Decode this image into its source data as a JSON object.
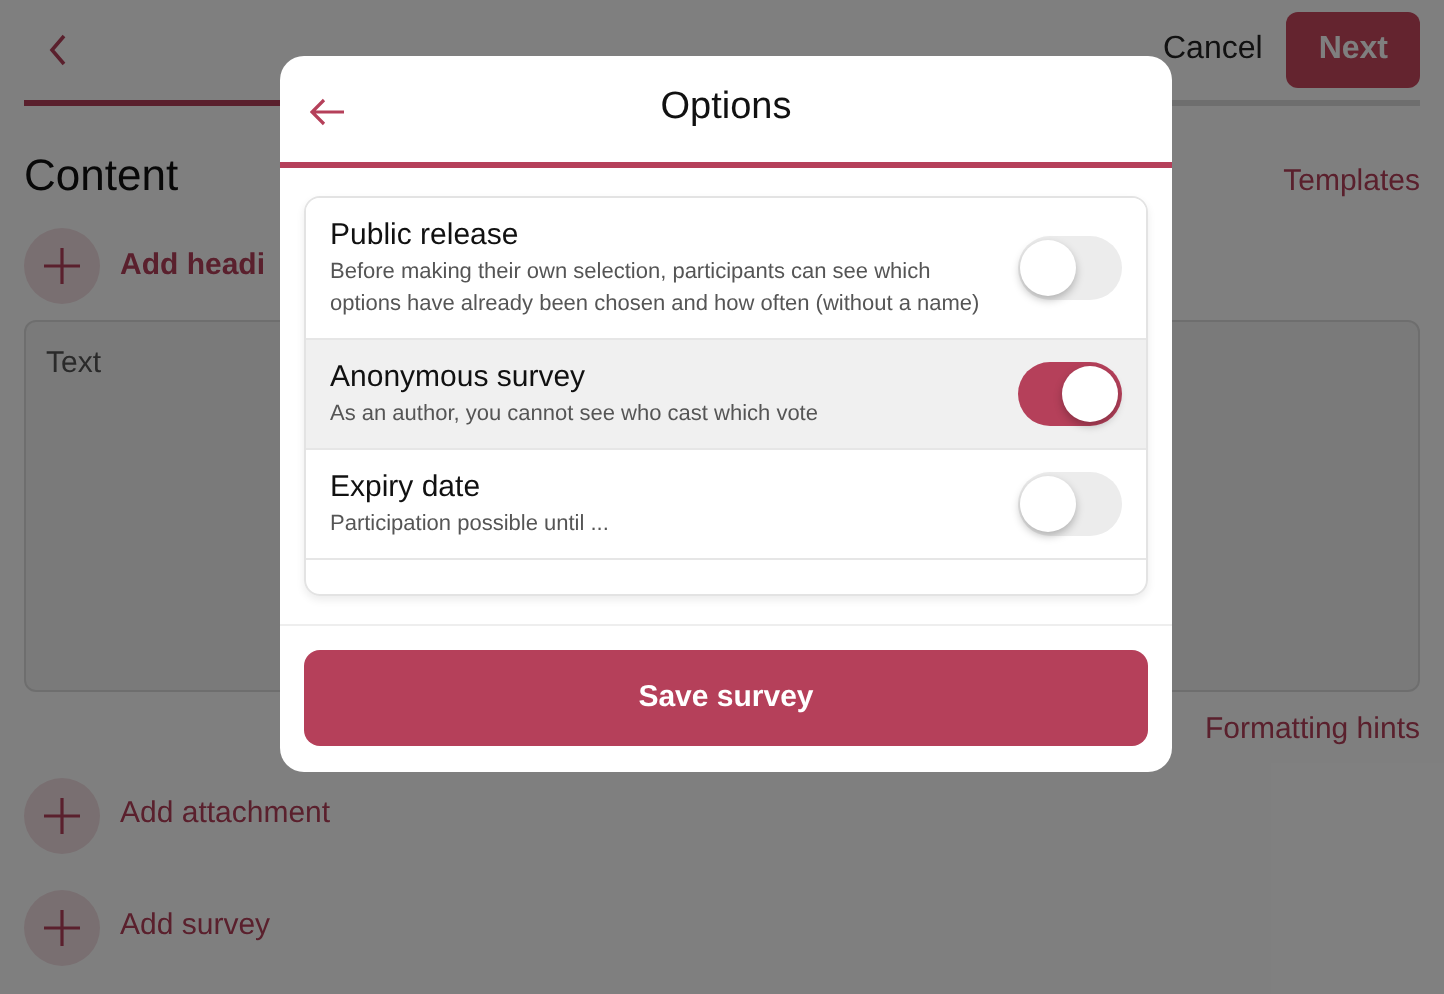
{
  "page": {
    "cancel": "Cancel",
    "next": "Next",
    "progress": {
      "level": 0.5
    },
    "heading": "Content",
    "templates": "Templates",
    "add_heading": "Add headi",
    "text_field": {
      "placeholder": "Text"
    },
    "formatting_hints": "Formatting hints",
    "actions": [
      {
        "label": "Add attachment"
      },
      {
        "label": "Add survey"
      }
    ]
  },
  "dialog": {
    "title": "Options",
    "options": [
      {
        "title": "Public release",
        "description": "Before making their own selection, participants can see which options have already been chosen and how often (without a name)",
        "on": false,
        "selected": false
      },
      {
        "title": "Anonymous survey",
        "description": "As an author, you cannot see who cast which vote",
        "on": true,
        "selected": true
      },
      {
        "title": "Expiry date",
        "description": "Participation possible until ...",
        "on": false,
        "selected": false
      }
    ],
    "save": "Save survey"
  }
}
